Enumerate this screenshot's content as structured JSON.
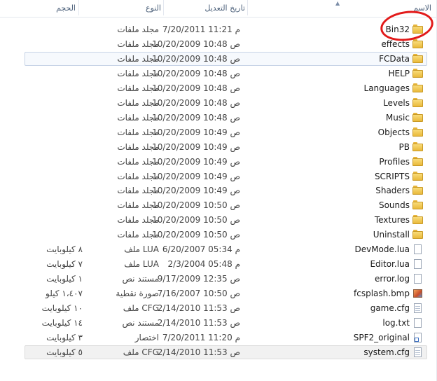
{
  "columns": {
    "name": "الاسم",
    "date": "تاريخ التعديل",
    "type": "النوع",
    "size": "الحجم"
  },
  "files": [
    {
      "name": "Bin32",
      "date": "7/20/2011 11:21 م",
      "type": "مجلد ملفات",
      "size": "",
      "icon": "folder-icon"
    },
    {
      "name": "effects",
      "date": "10/20/2009 10:48 ص",
      "type": "مجلد ملفات",
      "size": "",
      "icon": "folder-icon"
    },
    {
      "name": "FCData",
      "date": "10/20/2009 10:48 ص",
      "type": "مجلد ملفات",
      "size": "",
      "icon": "folder-icon"
    },
    {
      "name": "HELP",
      "date": "10/20/2009 10:48 ص",
      "type": "مجلد ملفات",
      "size": "",
      "icon": "folder-icon"
    },
    {
      "name": "Languages",
      "date": "10/20/2009 10:48 ص",
      "type": "مجلد ملفات",
      "size": "",
      "icon": "folder-icon"
    },
    {
      "name": "Levels",
      "date": "10/20/2009 10:48 ص",
      "type": "مجلد ملفات",
      "size": "",
      "icon": "folder-icon"
    },
    {
      "name": "Music",
      "date": "10/20/2009 10:48 ص",
      "type": "مجلد ملفات",
      "size": "",
      "icon": "folder-icon"
    },
    {
      "name": "Objects",
      "date": "10/20/2009 10:49 ص",
      "type": "مجلد ملفات",
      "size": "",
      "icon": "folder-icon"
    },
    {
      "name": "PB",
      "date": "10/20/2009 10:49 ص",
      "type": "مجلد ملفات",
      "size": "",
      "icon": "folder-icon"
    },
    {
      "name": "Profiles",
      "date": "10/20/2009 10:49 ص",
      "type": "مجلد ملفات",
      "size": "",
      "icon": "folder-icon"
    },
    {
      "name": "SCRIPTS",
      "date": "10/20/2009 10:49 ص",
      "type": "مجلد ملفات",
      "size": "",
      "icon": "folder-icon"
    },
    {
      "name": "Shaders",
      "date": "10/20/2009 10:49 ص",
      "type": "مجلد ملفات",
      "size": "",
      "icon": "folder-icon"
    },
    {
      "name": "Sounds",
      "date": "10/20/2009 10:50 ص",
      "type": "مجلد ملفات",
      "size": "",
      "icon": "folder-icon"
    },
    {
      "name": "Textures",
      "date": "10/20/2009 10:50 ص",
      "type": "مجلد ملفات",
      "size": "",
      "icon": "folder-icon"
    },
    {
      "name": "Uninstall",
      "date": "10/20/2009 10:50 ص",
      "type": "مجلد ملفات",
      "size": "",
      "icon": "folder-icon"
    },
    {
      "name": "DevMode.lua",
      "date": "6/20/2007 05:34 م",
      "type": "ملف LUA",
      "size": "٨ كيلوبايت",
      "icon": "document-icon"
    },
    {
      "name": "Editor.lua",
      "date": "2/3/2004 05:48 م",
      "type": "ملف LUA",
      "size": "٧ كيلوبايت",
      "icon": "document-icon"
    },
    {
      "name": "error.log",
      "date": "9/17/2009 12:35 ص",
      "type": "مستند نص",
      "size": "١ كيلوبايت",
      "icon": "document-icon"
    },
    {
      "name": "fcsplash.bmp",
      "date": "7/16/2007 10:50 ص",
      "type": "صورة نقطية",
      "size": "١،٤٠٧ كيلو",
      "icon": "image-icon"
    },
    {
      "name": "game.cfg",
      "date": "2/14/2010 11:53 ص",
      "type": "ملف CFG",
      "size": "١٠ كيلوبايت",
      "icon": "config-icon"
    },
    {
      "name": "log.txt",
      "date": "2/14/2010 11:53 ص",
      "type": "مستند نص",
      "size": "١٤ كيلوبايت",
      "icon": "document-icon"
    },
    {
      "name": "SPF2_original",
      "date": "7/20/2011 11:20 م",
      "type": "اختصار",
      "size": "٣ كيلوبايت",
      "icon": "shortcut-icon"
    },
    {
      "name": "system.cfg",
      "date": "2/14/2010 11:53 ص",
      "type": "ملف CFG",
      "size": "٥ كيلوبايت",
      "icon": "config-icon"
    }
  ],
  "highlight": {
    "annotated_item": "Bin32",
    "annotation_color": "#e21a1a"
  },
  "colors": {
    "selection": "#f6f9fd",
    "folder": "#e9b93a",
    "header_text": "#4c607a"
  }
}
